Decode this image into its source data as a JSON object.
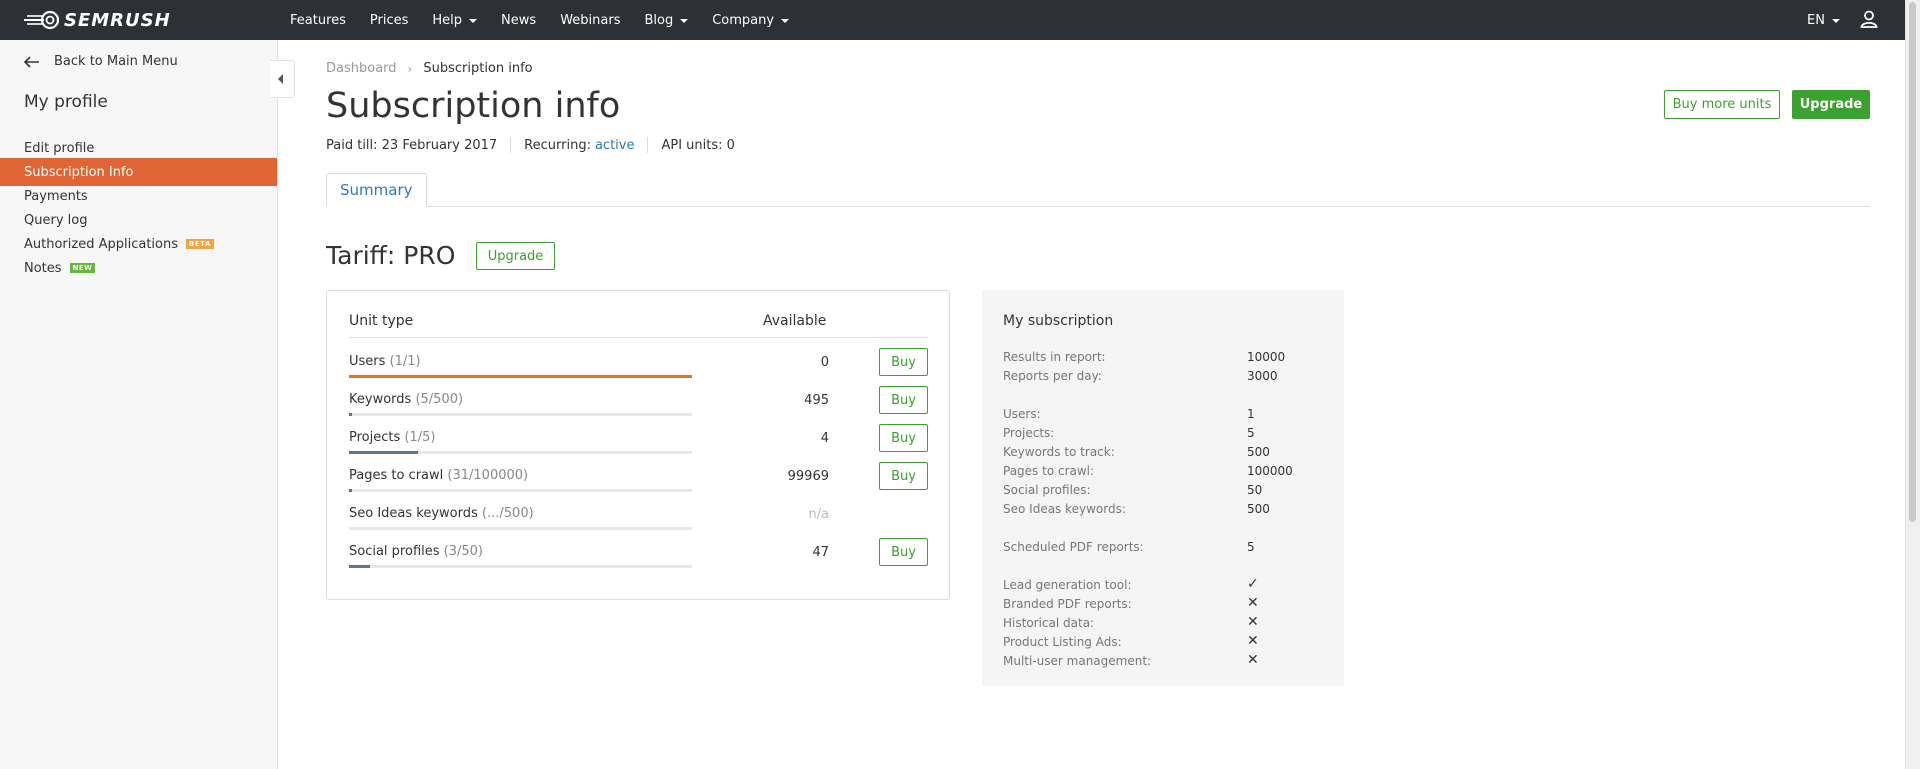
{
  "header": {
    "logo_text": "SEMRUSH",
    "nav": [
      {
        "label": "Features",
        "dropdown": false
      },
      {
        "label": "Prices",
        "dropdown": false
      },
      {
        "label": "Help",
        "dropdown": true
      },
      {
        "label": "News",
        "dropdown": false
      },
      {
        "label": "Webinars",
        "dropdown": false
      },
      {
        "label": "Blog",
        "dropdown": true
      },
      {
        "label": "Company",
        "dropdown": true
      }
    ],
    "language": "EN"
  },
  "sidebar": {
    "back_label": "Back to Main Menu",
    "title": "My profile",
    "items": [
      {
        "label": "Edit profile",
        "active": false,
        "badge": ""
      },
      {
        "label": "Subscription Info",
        "active": true,
        "badge": ""
      },
      {
        "label": "Payments",
        "active": false,
        "badge": ""
      },
      {
        "label": "Query log",
        "active": false,
        "badge": ""
      },
      {
        "label": "Authorized Applications",
        "active": false,
        "badge": "BETA"
      },
      {
        "label": "Notes",
        "active": false,
        "badge": "NEW"
      }
    ]
  },
  "main": {
    "breadcrumb": [
      "Dashboard",
      "Subscription info"
    ],
    "title": "Subscription info",
    "meta": {
      "paid_till": "Paid till: 23 February 2017",
      "recurring_label": "Recurring:",
      "recurring_value": "active",
      "api_units": "API units: 0"
    },
    "buttons": {
      "buy_more": "Buy more units",
      "upgrade": "Upgrade"
    },
    "tab": "Summary",
    "tariff": {
      "title": "Tariff: PRO",
      "upgrade_label": "Upgrade"
    },
    "units": {
      "col_unit_type": "Unit type",
      "col_available": "Available",
      "buy_label": "Buy",
      "rows": [
        {
          "name": "Users",
          "count": "(1/1)",
          "available": "0",
          "fill": 1.0,
          "color": "#e8702a",
          "buy": true
        },
        {
          "name": "Keywords",
          "count": "(5/500)",
          "available": "495",
          "fill": 0.01,
          "color": "#5a7a8c",
          "buy": true
        },
        {
          "name": "Projects",
          "count": "(1/5)",
          "available": "4",
          "fill": 0.2,
          "color": "#5a7a8c",
          "buy": true
        },
        {
          "name": "Pages to crawl",
          "count": "(31/100000)",
          "available": "99969",
          "fill": 0.0003,
          "color": "#5a7a8c",
          "buy": true
        },
        {
          "name": "Seo Ideas keywords",
          "count": "(.../500)",
          "available": "n/a",
          "fill": 0,
          "color": "#5a7a8c",
          "buy": false
        },
        {
          "name": "Social profiles",
          "count": "(3/50)",
          "available": "47",
          "fill": 0.06,
          "color": "#5a7a8c",
          "buy": true
        }
      ]
    },
    "subscription": {
      "title": "My subscription",
      "groups": [
        [
          {
            "label": "Results in report:",
            "value": "10000"
          },
          {
            "label": "Reports per day:",
            "value": "3000"
          }
        ],
        [
          {
            "label": "Users:",
            "value": "1"
          },
          {
            "label": "Projects:",
            "value": "5"
          },
          {
            "label": "Keywords to track:",
            "value": "500"
          },
          {
            "label": "Pages to crawl:",
            "value": "100000"
          },
          {
            "label": "Social profiles:",
            "value": "50"
          },
          {
            "label": "Seo Ideas keywords:",
            "value": "500"
          }
        ],
        [
          {
            "label": "Scheduled PDF reports:",
            "value": "5"
          }
        ],
        [
          {
            "label": "Lead generation tool:",
            "value": "✓"
          },
          {
            "label": "Branded PDF reports:",
            "value": "✕"
          },
          {
            "label": "Historical data:",
            "value": "✕"
          },
          {
            "label": "Product Listing Ads:",
            "value": "✕"
          },
          {
            "label": "Multi-user management:",
            "value": "✕"
          }
        ]
      ]
    }
  },
  "icons": {
    "back": "arrow-left-icon",
    "user": "user-icon",
    "collapse": "collapse-left-icon",
    "logo": "semrush-fireball-logo"
  },
  "colors": {
    "topbar": "#2d3135",
    "active_sidebar": "#e06535",
    "green": "#3ba22f",
    "link": "#2b7bb9"
  }
}
